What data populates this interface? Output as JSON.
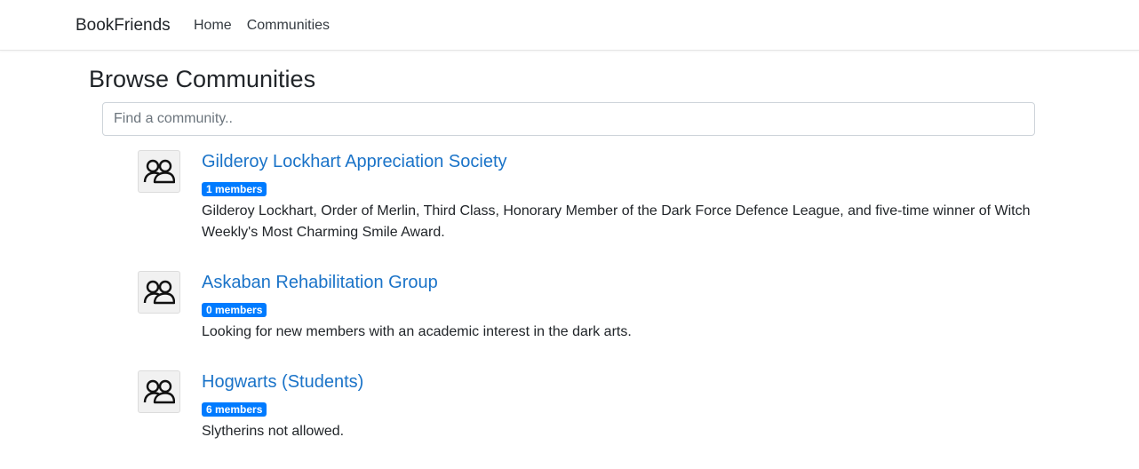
{
  "nav": {
    "brand": "BookFriends",
    "links": [
      "Home",
      "Communities"
    ]
  },
  "page": {
    "title": "Browse Communities",
    "search_placeholder": "Find a community.."
  },
  "communities": [
    {
      "name": "Gilderoy Lockhart Appreciation Society",
      "members": "1 members",
      "description": "Gilderoy Lockhart, Order of Merlin, Third Class, Honorary Member of the Dark Force Defence League, and five-time winner of Witch Weekly's Most Charming Smile Award.",
      "icon": "people-icon"
    },
    {
      "name": "Askaban Rehabilitation Group",
      "members": "0 members",
      "description": "Looking for new members with an academic interest in the dark arts.",
      "icon": "people-icon"
    },
    {
      "name": "Hogwarts (Students)",
      "members": "6 members",
      "description": "Slytherins not allowed.",
      "icon": "people-icon"
    }
  ],
  "colors": {
    "link": "#1a73c8",
    "badge": "#007bff"
  }
}
